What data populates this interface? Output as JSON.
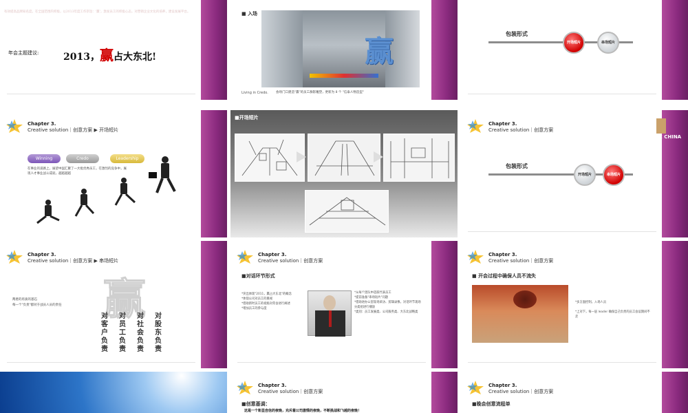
{
  "slides": {
    "s1": {
      "body_text": "有效提高品牌知名度，在全国范围内积极，以2013年度工作宗旨：'赢'，激发员工的积极心态，对营销企业文化的培养，建设发展平台。",
      "theme_label": "年会主题建议:",
      "theme_prefix": "2013，",
      "theme_accent": "赢",
      "theme_suffix": "占大东北!"
    },
    "s2": {
      "section": "入场",
      "caption_left": "Living in Credo.",
      "caption_right": "会场门口建造\"赢\"的员工群影雕塑，更新为 8 个 \"信泰人物造型\"",
      "sculpture_char": "赢"
    },
    "s3": {
      "section": "包装形式",
      "btn_red": "开场短片",
      "btn_grey": "串场短片"
    },
    "s4": {
      "chapter": "Chapter 3.",
      "subtitle": "Creative solution｜创意方案 ▶ 开场短片",
      "pills": [
        "Winning",
        "Credo",
        "Leadership"
      ],
      "desc": "在事业的道路上，展望中国汇聚了一大批优秀员工，在激烈的竞争中，展现人才事业战斗成就，越越越越"
    },
    "s5": {
      "section": "开场短片"
    },
    "s6": {
      "chapter": "Chapter 3.",
      "subtitle": "Creative solution｜创意方案",
      "section": "包装形式",
      "btn_grey": "开场短片",
      "btn_red": "串场短片",
      "logo_text": "E CHINA"
    },
    "s7": {
      "chapter": "Chapter 3.",
      "subtitle": "Creative solution｜创意方案 ▶ 串场短片",
      "note1": "两者的有质的基石",
      "note2": "每一个\"负责\"都对于战员人员的责任",
      "big_char": "赢",
      "cols": [
        "对客户负责",
        "对员工负责",
        "对社会负责",
        "对股东负责"
      ]
    },
    "s8": {
      "chapter": "Chapter 3.",
      "subtitle": "Creative solution｜创意方案",
      "section": "对话环节形式",
      "left_lines": [
        "*突出体现\"2011，赢占大东北\"的概念",
        "*体现公司对员工的重视",
        "*借助新时员工的视角对年会进行阐述",
        "*增加员工的参与度"
      ],
      "right_lines": [
        "*从每个团队中选取代表员工",
        "*提前准备\"串场短片\"问题",
        "*借助进办公室现场采访、剪辑录像，对话环节现场",
        "  分类组进行播放",
        "*类别：员工发展类、公司服务类、大东北战略类"
      ]
    },
    "s9": {
      "chapter": "Chapter 3.",
      "subtitle": "Creative solution｜创意方案",
      "section": "开会过程中确保人员不流失",
      "note1": "*多方面控制，入场人员",
      "note2": "*上对下，每一层 leader 确保自己负责的员工会议期间不",
      "note3": "  走"
    },
    "s11": {
      "chapter": "Chapter 3.",
      "subtitle": "Creative solution｜创意方案",
      "section": "创意基调：",
      "body": "这是一个彰显自信的夜晚，充斥着公司激情的夜晚，不断挑战和飞越的夜晚！"
    },
    "s12": {
      "chapter": "Chapter 3.",
      "subtitle": "Creative solution｜创意方案",
      "section": "晚会创意流程单"
    }
  },
  "colors": {
    "sidebar": "#8a2a7e",
    "accent_red": "#d10000",
    "text_dark": "#333333"
  }
}
